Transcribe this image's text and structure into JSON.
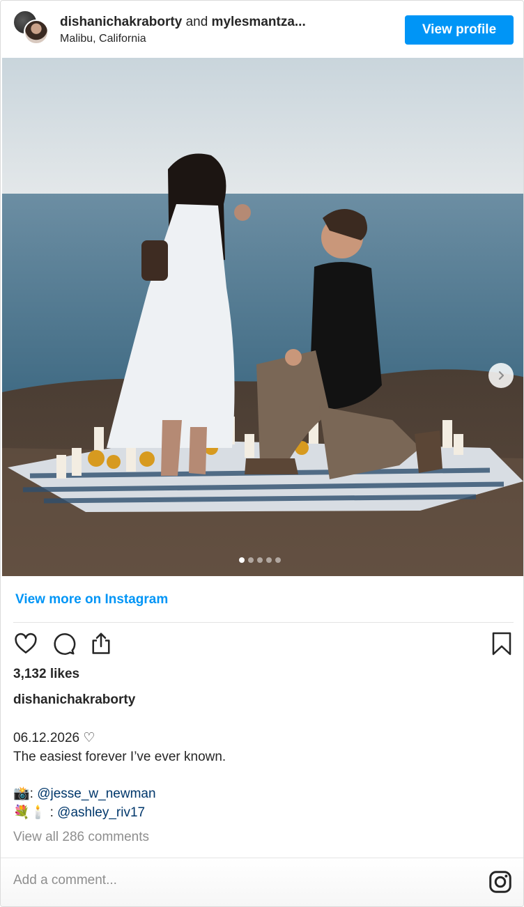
{
  "header": {
    "user1": "dishanichakraborty",
    "and": "and",
    "user2": "mylesmantza...",
    "location": "Malibu, California",
    "view_profile": "View profile"
  },
  "carousel": {
    "total": 5,
    "active_index": 0
  },
  "view_more": "View more on Instagram",
  "stats": {
    "likes": "3,132 likes"
  },
  "caption": {
    "owner": "dishanichakraborty",
    "date_line": "06.12.2026 ♡",
    "text": "The easiest forever I’ve ever known.",
    "credit1_emoji": "📸:",
    "credit1_mention": "@jesse_w_newman",
    "credit2_emoji": "💐🕯️ :",
    "credit2_mention": "@ashley_riv17"
  },
  "view_comments": "View all 286 comments",
  "comment": {
    "placeholder": "Add a comment..."
  },
  "icons": [
    "like-icon",
    "comment-icon",
    "share-icon",
    "save-icon",
    "instagram-icon",
    "chevron-right-icon"
  ],
  "colors": {
    "accent": "#0095f6",
    "mention": "#00376b",
    "muted": "#8e8e8e"
  }
}
